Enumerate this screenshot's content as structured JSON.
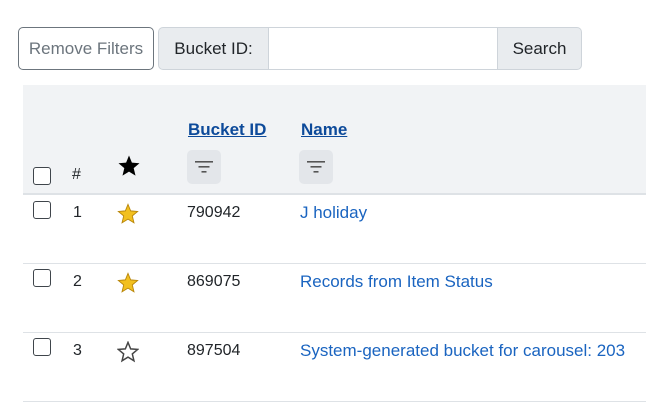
{
  "filters": {
    "remove_label": "Remove Filters",
    "bucket_id_label": "Bucket ID:",
    "bucket_id_value": "",
    "search_label": "Search"
  },
  "table": {
    "columns": {
      "number": "#",
      "bucket_id": "Bucket ID",
      "name": "Name"
    },
    "rows": [
      {
        "number": "1",
        "starred": true,
        "bucket_id": "790942",
        "name": "J holiday"
      },
      {
        "number": "2",
        "starred": true,
        "bucket_id": "869075",
        "name": "Records from Item Status"
      },
      {
        "number": "3",
        "starred": false,
        "bucket_id": "897504",
        "name": "System-generated bucket for carousel: 203"
      }
    ]
  },
  "colors": {
    "star_filled": "#f2c01f",
    "link": "#1a64c0",
    "header_link": "#0d4a9a"
  }
}
